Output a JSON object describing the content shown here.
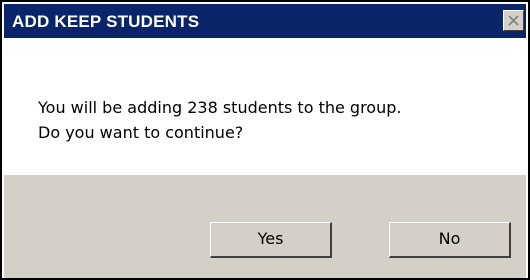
{
  "dialog": {
    "title": "ADD KEEP STUDENTS",
    "close_icon": "close-icon",
    "message_line1": "You will be adding 238 students to the group.",
    "message_line2": "Do you want to continue?",
    "yes_label": "Yes",
    "no_label": "No"
  },
  "colors": {
    "titlebar": "#0a246a",
    "title_text": "#ffffff",
    "button_face": "#d4d0c8",
    "content_bg": "#ffffff"
  }
}
